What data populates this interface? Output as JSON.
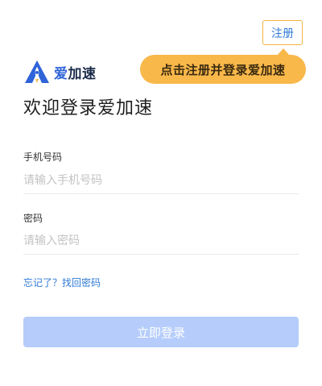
{
  "header": {
    "register_label": "注册",
    "tooltip_text": "点击注册并登录爱加速"
  },
  "logo": {
    "text_part1": "爱",
    "text_part2": "加速"
  },
  "main": {
    "title": "欢迎登录爱加速",
    "phone": {
      "label": "手机号码",
      "placeholder": "请输入手机号码",
      "value": ""
    },
    "password": {
      "label": "密码",
      "placeholder": "请输入密码",
      "value": ""
    },
    "forgot_link": "忘记了？找回密码",
    "login_label": "立即登录"
  },
  "colors": {
    "accent": "#2f7bd8",
    "tooltip": "#f9b84a",
    "button_disabled": "#b6cdfb"
  }
}
